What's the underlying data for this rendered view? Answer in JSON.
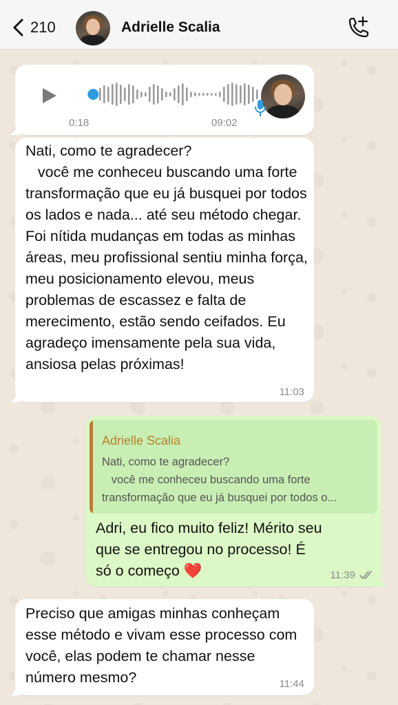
{
  "header": {
    "back_count": "210",
    "contact_name": "Adrielle Scalia"
  },
  "audio": {
    "elapsed": "0:18",
    "duration": "09:02",
    "progress_fraction": 0.03
  },
  "messages": [
    {
      "direction": "incoming",
      "text": "Nati, como te agradecer?\n   você me conheceu buscando uma forte transformação que eu já busquei por todos os lados e nada... até seu método chegar.   Foi nítida mudanças em todas as minhas áreas, meu profissional sentiu minha força, meu posicionamento elevou, meus problemas de escassez e falta de merecimento, estão sendo ceifados. Eu agradeço imensamente pela sua vida, ansiosa pelas próximas!",
      "time": "11:03"
    },
    {
      "direction": "outgoing",
      "quote_author": "Adrielle Scalia",
      "quote_text": "Nati, como te agradecer?\n   você me conheceu buscando uma forte transformação que eu já busquei por todos o...",
      "text": "Adri, eu fico muito feliz! Mérito seu que se entregou no processo! É só o começo",
      "emoji": "❤️",
      "time": "11:39",
      "status": "read"
    },
    {
      "direction": "incoming",
      "text": "Preciso que amigas minhas conheçam esse método e vivam esse processo com você, elas podem te chamar nesse número mesmo?",
      "time": "11:44"
    }
  ],
  "colors": {
    "incoming_bubble": "#ffffff",
    "outgoing_bubble": "#dcf8c6",
    "quote_accent": "#b5822e",
    "audio_accent": "#2f9be0",
    "wallpaper": "#efe7dc"
  },
  "icons": [
    "back-chevron-icon",
    "add-call-icon",
    "play-icon",
    "microphone-icon",
    "read-ticks-icon",
    "heart-emoji"
  ]
}
